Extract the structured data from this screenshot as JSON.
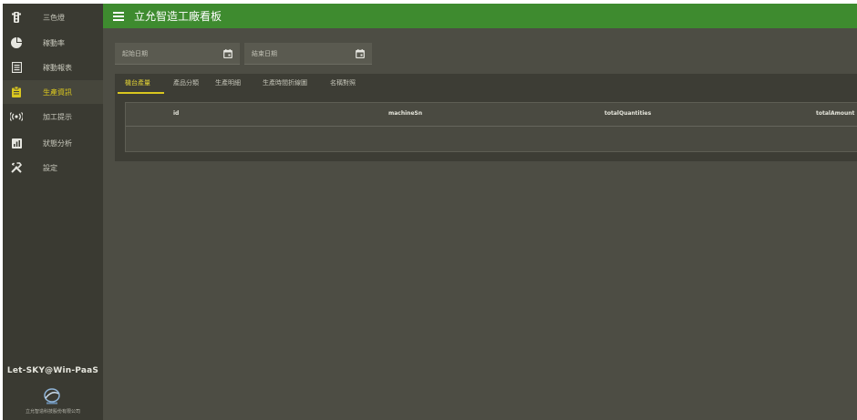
{
  "app": {
    "title": "立允智造工廠看板"
  },
  "sidebar": {
    "items": [
      {
        "label": "三色燈",
        "icon": "traffic-light-icon"
      },
      {
        "label": "稼動率",
        "icon": "pie-chart-icon"
      },
      {
        "label": "稼動報表",
        "icon": "report-icon"
      },
      {
        "label": "生產資訊",
        "icon": "clipboard-icon",
        "active": true
      },
      {
        "label": "加工提示",
        "icon": "broadcast-icon"
      },
      {
        "label": "狀態分析",
        "icon": "bar-chart-icon"
      },
      {
        "label": "設定",
        "icon": "tools-icon"
      }
    ],
    "brand": "Let-SKY@Win-PaaS",
    "company": "立允智造科技股份有限公司"
  },
  "filters": {
    "start_date": {
      "placeholder": "起始日期"
    },
    "end_date": {
      "placeholder": "結束日期"
    }
  },
  "tabs": [
    {
      "label": "機台產量",
      "active": true
    },
    {
      "label": "產品分類"
    },
    {
      "label": "生產明細"
    },
    {
      "label": "生產時間折線圖"
    },
    {
      "label": "名稱對照"
    }
  ],
  "table": {
    "columns": [
      "id",
      "machineSn",
      "totalQuantities",
      "totalAmount"
    ],
    "rows": []
  },
  "colors": {
    "header_green": "#3e8b2f",
    "accent_yellow": "#d9c61f",
    "sidebar_bg": "#3a3a32",
    "content_bg": "#4d4d44"
  }
}
